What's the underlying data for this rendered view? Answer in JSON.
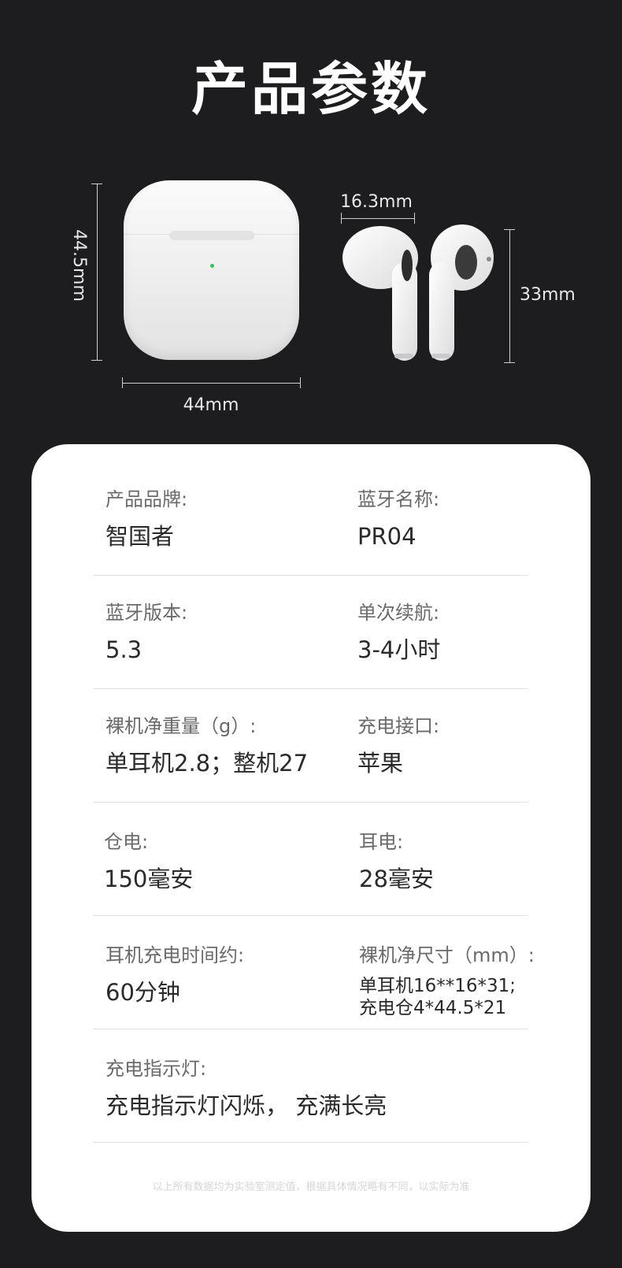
{
  "title": "产品参数",
  "dimensions": {
    "case_height": "44.5mm",
    "case_width": "44mm",
    "earbud_width": "16.3mm",
    "earbud_height": "33mm"
  },
  "specs": [
    {
      "label": "产品品牌:",
      "value": "智国者"
    },
    {
      "label": "蓝牙名称:",
      "value": "PR04"
    },
    {
      "label": "蓝牙版本:",
      "value": "5.3"
    },
    {
      "label": "单次续航:",
      "value": "3-4小时"
    },
    {
      "label": "裸机净重量（g）:",
      "value": "单耳机2.8；整机27"
    },
    {
      "label": "充电接口:",
      "value": "苹果"
    },
    {
      "label": "仓电:",
      "value": "150毫安"
    },
    {
      "label": "耳电:",
      "value": "28毫安"
    },
    {
      "label": "耳机充电时间约:",
      "value": "60分钟"
    },
    {
      "label": "裸机净尺寸（mm）:",
      "value_lines": [
        "单耳机16**16*31;",
        "充电仓4*44.5*21"
      ]
    },
    {
      "label": "充电指示灯:",
      "value": "充电指示灯闪烁， 充满长亮"
    }
  ],
  "footnote": "以上所有数据均为实验室测定值，根据具体情况略有不同，以实际为准",
  "colors": {
    "background": "#1d1d1f",
    "card": "#ffffff",
    "led": "#1fd14a"
  }
}
